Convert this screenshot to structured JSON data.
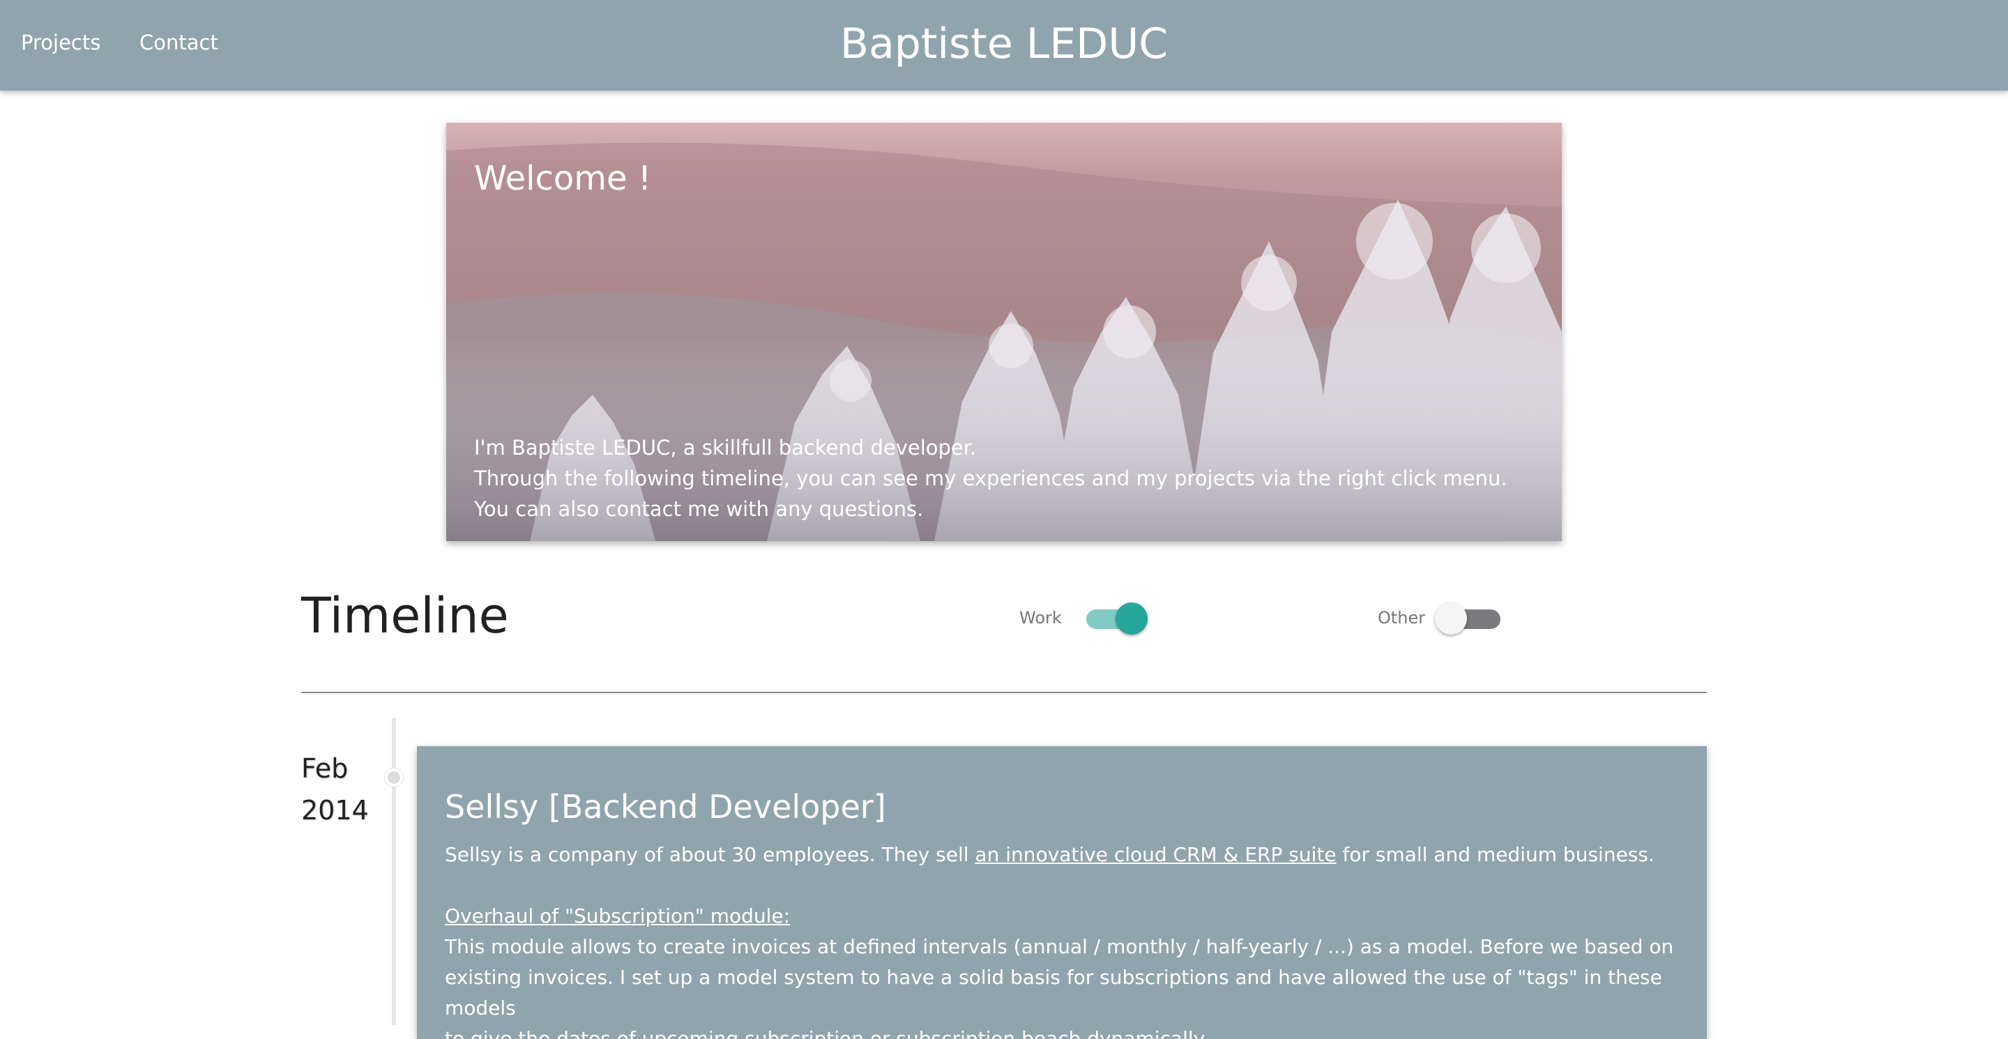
{
  "header": {
    "nav": {
      "projects": "Projects",
      "contact": "Contact"
    },
    "title": "Baptiste LEDUC",
    "background_color": "#90a4ae"
  },
  "hero": {
    "heading": "Welcome !",
    "lines": [
      "I'm Baptiste LEDUC, a skillfull backend developer.",
      "Through the following timeline, you can see my experiences and my projects via the right click menu.",
      "You can also contact me with any questions."
    ]
  },
  "timeline": {
    "title": "Timeline",
    "filters": {
      "work": {
        "label": "Work",
        "on": true,
        "color": "#26a69a"
      },
      "other": {
        "label": "Other",
        "on": false
      }
    },
    "entries": [
      {
        "date_month": "Feb",
        "date_year": "2014",
        "title": "Sellsy [Backend Developer]",
        "intro_before": "Sellsy is a company of about 30 employees. They sell ",
        "intro_link": "an innovative cloud CRM & ERP suite",
        "intro_after": " for small and medium business.",
        "section_heading": "Overhaul of \"Subscription\" module:",
        "section_lines": [
          "This module allows to create invoices at defined intervals (annual / monthly / half-yearly / ...) as a model. Before we based on",
          "existing invoices. I set up a model system to have a solid basis for subscriptions and have allowed the use of \"tags\" in these models",
          "to give the dates of upcoming subscription or subscription beach dynamically."
        ]
      }
    ]
  }
}
